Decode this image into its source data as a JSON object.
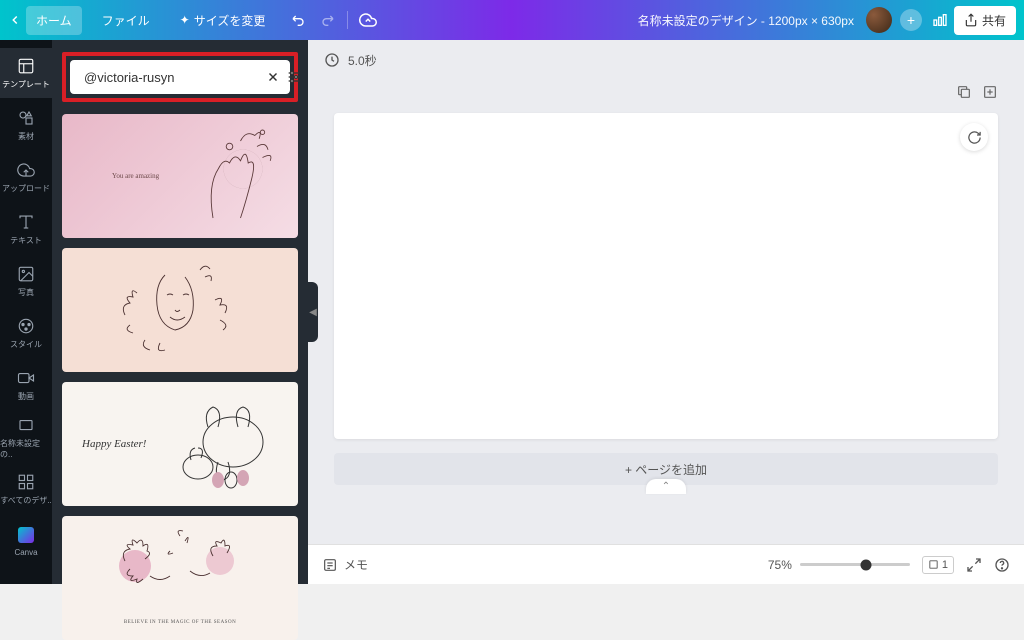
{
  "topbar": {
    "home": "ホーム",
    "file": "ファイル",
    "resize": "サイズを変更",
    "title": "名称未設定のデザイン - 1200px × 630px",
    "share": "共有"
  },
  "rail": {
    "templates": "テンプレート",
    "elements": "素材",
    "uploads": "アップロード",
    "text": "テキスト",
    "photos": "写真",
    "styles": "スタイル",
    "videos": "動画",
    "untitled": "名称未設定の..",
    "all_designs": "すべてのデザ..",
    "canva": "Canva"
  },
  "search": {
    "value": "@victoria-rusyn"
  },
  "templates": {
    "t1_text": "You are amazing",
    "t3_text": "Happy Easter!",
    "t4_text": "BELIEVE IN THE MAGIC OF THE SEASON"
  },
  "canvas": {
    "duration": "5.0秒",
    "add_page": "+ ページを追加",
    "page_indicator": "⌃"
  },
  "bottom": {
    "memo": "メモ",
    "zoom": "75%",
    "page_count": "1"
  }
}
